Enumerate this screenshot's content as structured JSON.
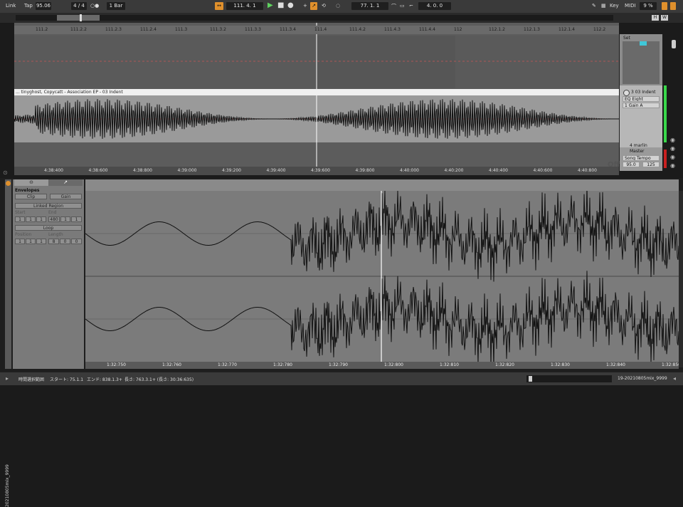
{
  "topbar": {
    "link": "Link",
    "tap": "Tap",
    "tempo": "95.06",
    "signature": "4 / 4",
    "metro": "○●",
    "quantize": "1 Bar",
    "position": "111.   4.   1",
    "loop_start": "77.   1.   1",
    "loop_length": "4.   0.   0",
    "key": "Key",
    "midi": "MIDI",
    "cpu": "9 %",
    "h_btn": "H",
    "w_btn": "W"
  },
  "ruler": [
    "111.2",
    "111.2.2",
    "111.2.3",
    "111.2.4",
    "111.3",
    "111.3.2",
    "111.3.3",
    "111.3.4",
    "111.4",
    "111.4.2",
    "111.4.3",
    "111.4.4",
    "112",
    "112.1.2",
    "112.1.3",
    "112.1.4",
    "112.2"
  ],
  "time_ruler": [
    "4:38:400",
    "4:38:600",
    "4:38:800",
    "4:39:000",
    "4:39:200",
    "4:39:400",
    "4:39:600",
    "4:39:800",
    "4:40:000",
    "4:40:200",
    "4:40:400",
    "4:40:600",
    "4:40:800"
  ],
  "clip": {
    "title": "... tinyghost, Copycatt - Association EP - 03 Indent"
  },
  "mixer": {
    "set": "Set",
    "track_name": "3 03 Indent",
    "device": "EQ Eight",
    "param": "1 Gain A",
    "next_track": "4 marlin",
    "master": "Master",
    "song_tempo": "Song Tempo",
    "tempo_low": "95.0",
    "tempo_high": "125",
    "off": "Off"
  },
  "envelopes": {
    "title": "Envelopes",
    "clip": "Clip",
    "gain": "Gain",
    "linked_region": "Linked Region",
    "start": "Start",
    "end": "End",
    "start_vals": [
      "1",
      "1",
      "1"
    ],
    "end_vals": [
      "480",
      "1",
      "1"
    ],
    "loop": "Loop",
    "position": "Position",
    "length": "Length",
    "pos_vals": [
      "1",
      "1",
      "1"
    ],
    "len_vals": [
      "8",
      "0",
      "0"
    ],
    "vertical_label": "20210805mix_9999"
  },
  "detail_ruler": [
    "1:32:750",
    "1:32:760",
    "1:32:770",
    "1:32:780",
    "1:32:790",
    "1:32:800",
    "1:32:810",
    "1:32:820",
    "1:32:830",
    "1:32:840",
    "1:32:850"
  ],
  "status": {
    "selection": "時間選択範囲",
    "start": "スタート: 75.1.1",
    "end": "エンド: 838.1.3+",
    "length": "長さ: 763.3.1+ (長さ: 30:36:635)",
    "track": "19-20210805mix_9999"
  },
  "colors": {
    "accent": "#e0902c",
    "play": "#5fd35f",
    "background": "#1b1b1b"
  }
}
